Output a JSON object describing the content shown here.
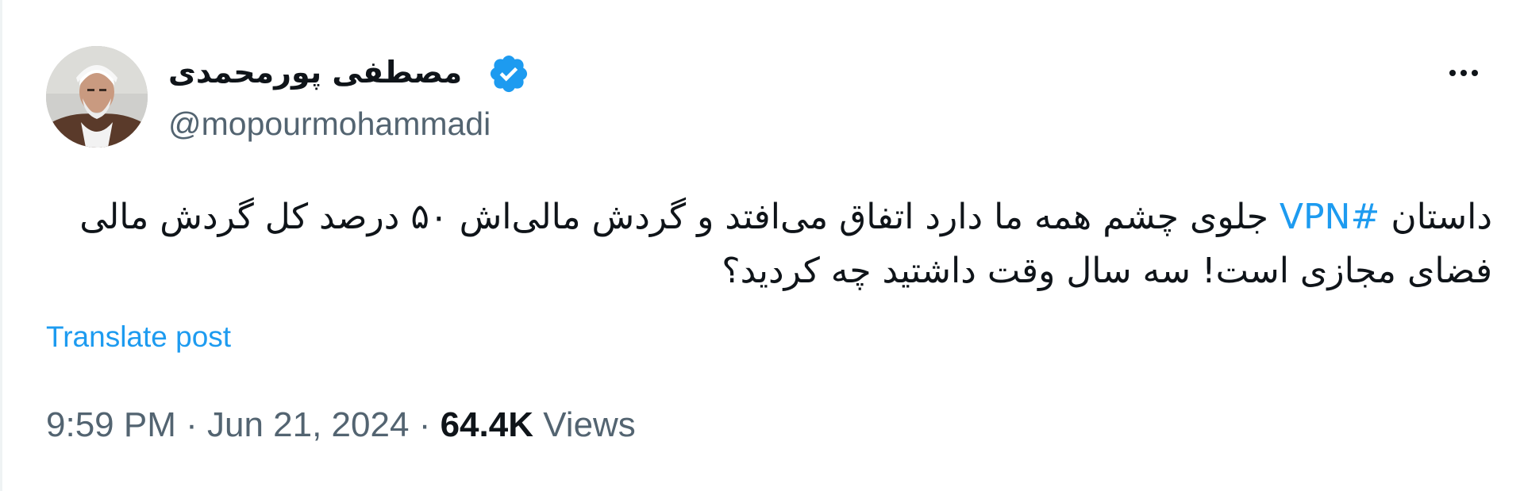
{
  "tweet": {
    "author": {
      "display_name": "مصطفی پورمحمدی",
      "handle": "@mopourmohammadi",
      "verified": true,
      "verified_color": "#1d9bf0"
    },
    "text_prefix": "داستان ",
    "hashtag": "#VPN",
    "text_suffix": " جلوی چشم همه ما دارد اتفاق می‌افتد و گردش مالی‌اش ۵۰ درصد کل گردش مالی فضای مجازی است! سه سال وقت داشتید چه کردید؟",
    "translate_label": "Translate post",
    "time": "9:59 PM",
    "separator": "·",
    "date": "Jun 21, 2024",
    "views_count": "64.4K",
    "views_label": "Views"
  },
  "icons": {
    "more": "more-horizontal-icon",
    "verified": "verified-badge-icon"
  },
  "colors": {
    "link": "#1d9bf0",
    "text": "#0f1419",
    "secondary": "#536471"
  }
}
